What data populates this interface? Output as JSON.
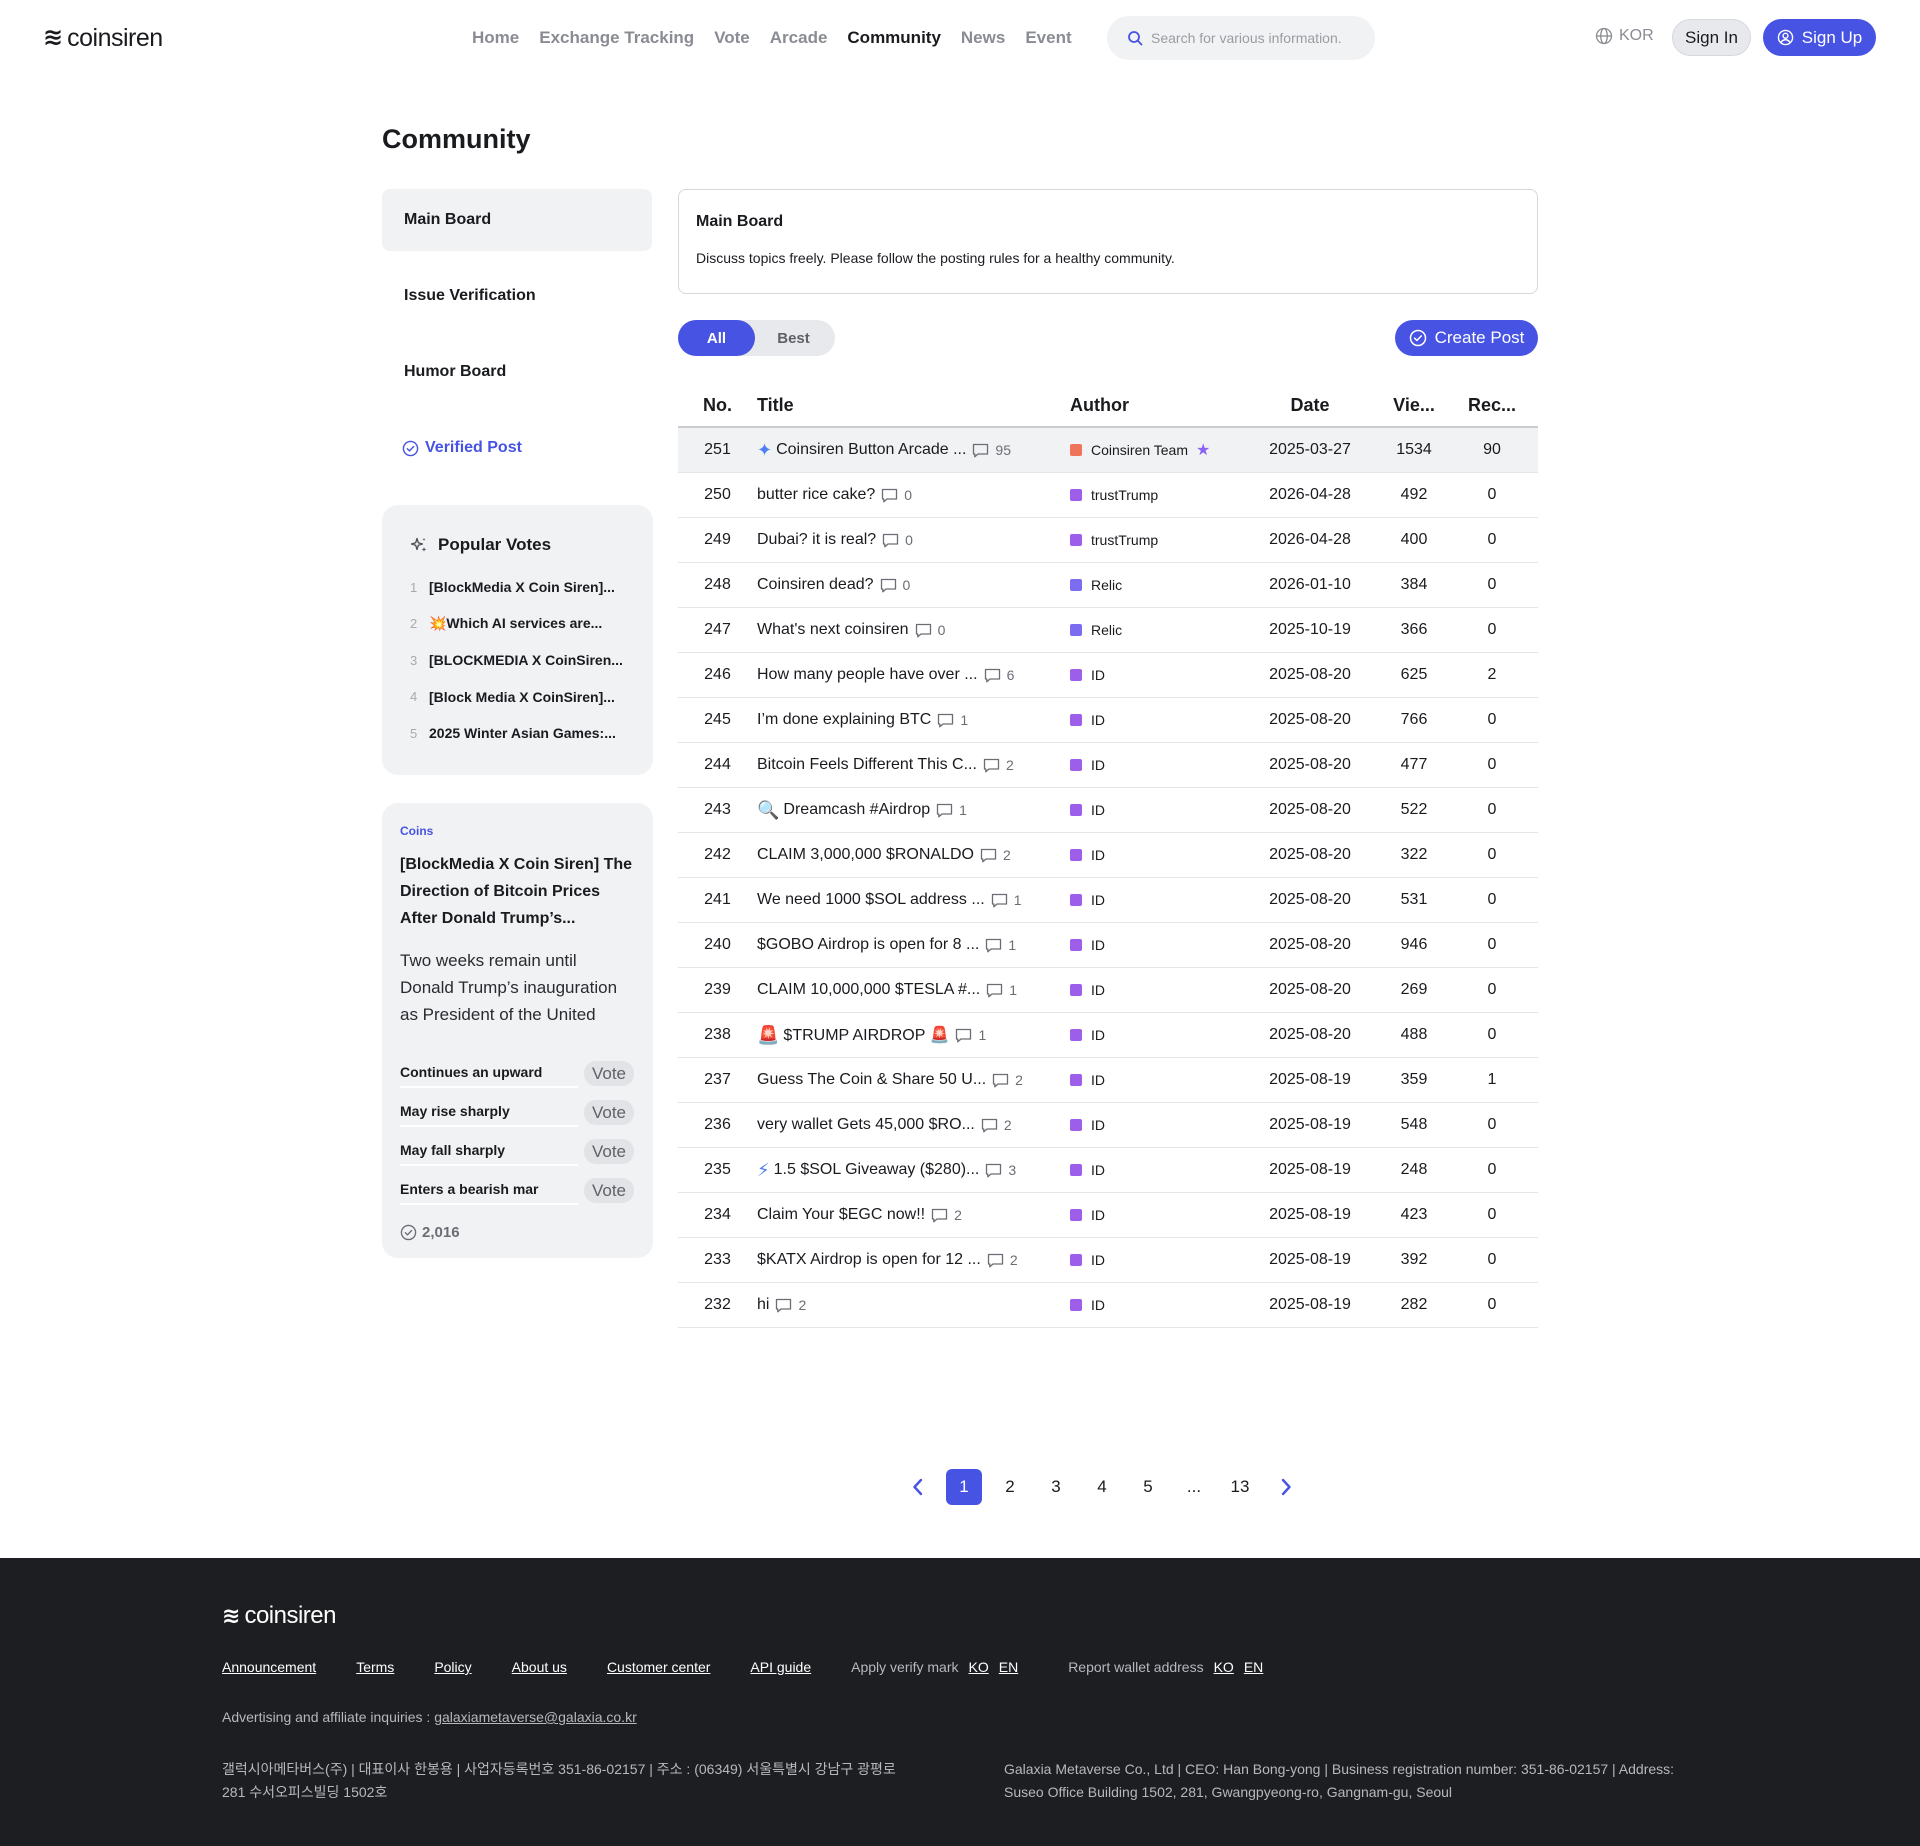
{
  "header": {
    "logo_mark": "≋",
    "logo_text": "coinsiren",
    "nav": [
      "Home",
      "Exchange Tracking",
      "Vote",
      "Arcade",
      "Community",
      "News",
      "Event"
    ],
    "active_nav": "Community",
    "search_placeholder": "Search for various information.",
    "lang": "KOR",
    "sign_in": "Sign In",
    "sign_up": "Sign Up",
    "accent_color": "#4753e3"
  },
  "page_title": "Community",
  "sidebar": {
    "items": [
      {
        "label": "Main Board",
        "active": true
      },
      {
        "label": "Issue Verification",
        "active": false
      },
      {
        "label": "Humor Board",
        "active": false
      },
      {
        "label": "Verified Post",
        "active": false
      }
    ],
    "popular_votes": {
      "title": "Popular Votes",
      "items": [
        {
          "num": "1",
          "text": "[BlockMedia X Coin Siren]..."
        },
        {
          "num": "2",
          "text": "💥Which AI services are..."
        },
        {
          "num": "3",
          "text": "[BLOCKMEDIA X CoinSiren..."
        },
        {
          "num": "4",
          "text": "[Block Media X CoinSiren]..."
        },
        {
          "num": "5",
          "text": "2025 Winter Asian Games:..."
        }
      ]
    },
    "vote_card": {
      "category": "Coins",
      "title": "[BlockMedia X Coin Siren] The Direction of Bitcoin Prices After Donald Trump’s...",
      "description": "Two weeks remain until Donald Trump’s inauguration as President of the United State...",
      "options": [
        {
          "label": "Continues an upward",
          "button": "Vote"
        },
        {
          "label": "May rise sharply",
          "button": "Vote"
        },
        {
          "label": "May fall sharply",
          "button": "Vote"
        },
        {
          "label": "Enters a bearish mar",
          "button": "Vote"
        }
      ],
      "count": "2,016"
    }
  },
  "board": {
    "title": "Main Board",
    "description": "Discuss topics freely. Please follow the posting rules for a healthy community.",
    "filters": [
      "All",
      "Best"
    ],
    "active_filter": "All",
    "create_post": "Create Post",
    "columns": [
      "No.",
      "Title",
      "Author",
      "Date",
      "Vie...",
      "Rec..."
    ],
    "rows": [
      {
        "no": "251",
        "prefix": "✦",
        "title": "Coinsiren Button Arcade ...",
        "comments": "95",
        "author": "Coinsiren Team",
        "level": "team",
        "star": true,
        "date": "2025-03-27",
        "views": "1534",
        "rec": "90",
        "pinned": true
      },
      {
        "no": "250",
        "prefix": "",
        "title": "butter rice cake?",
        "comments": "0",
        "author": "trustTrump",
        "level": "normal",
        "star": false,
        "date": "2026-04-28",
        "views": "492",
        "rec": "0",
        "pinned": false
      },
      {
        "no": "249",
        "prefix": "",
        "title": "Dubai? it is real?",
        "comments": "0",
        "author": "trustTrump",
        "level": "normal",
        "star": false,
        "date": "2026-04-28",
        "views": "400",
        "rec": "0",
        "pinned": false
      },
      {
        "no": "248",
        "prefix": "",
        "title": "Coinsiren dead?",
        "comments": "0",
        "author": "Relic",
        "level": "relic",
        "star": false,
        "date": "2026-01-10",
        "views": "384",
        "rec": "0",
        "pinned": false
      },
      {
        "no": "247",
        "prefix": "",
        "title": "What's next coinsiren",
        "comments": "0",
        "author": "Relic",
        "level": "relic",
        "star": false,
        "date": "2025-10-19",
        "views": "366",
        "rec": "0",
        "pinned": false
      },
      {
        "no": "246",
        "prefix": "",
        "title": "How many people have over ...",
        "comments": "6",
        "author": "ID",
        "level": "normal",
        "star": false,
        "date": "2025-08-20",
        "views": "625",
        "rec": "2",
        "pinned": false
      },
      {
        "no": "245",
        "prefix": "",
        "title": "I’m done explaining BTC",
        "comments": "1",
        "author": "ID",
        "level": "normal",
        "star": false,
        "date": "2025-08-20",
        "views": "766",
        "rec": "0",
        "pinned": false
      },
      {
        "no": "244",
        "prefix": "",
        "title": "Bitcoin Feels Different This C...",
        "comments": "2",
        "author": "ID",
        "level": "normal",
        "star": false,
        "date": "2025-08-20",
        "views": "477",
        "rec": "0",
        "pinned": false
      },
      {
        "no": "243",
        "prefix": "🔍",
        "title": "Dreamcash #Airdrop",
        "comments": "1",
        "author": "ID",
        "level": "normal",
        "star": false,
        "date": "2025-08-20",
        "views": "522",
        "rec": "0",
        "pinned": false
      },
      {
        "no": "242",
        "prefix": "",
        "title": "CLAIM 3,000,000 $RONALDO",
        "comments": "2",
        "author": "ID",
        "level": "normal",
        "star": false,
        "date": "2025-08-20",
        "views": "322",
        "rec": "0",
        "pinned": false
      },
      {
        "no": "241",
        "prefix": "",
        "title": "We need 1000 $SOL address ...",
        "comments": "1",
        "author": "ID",
        "level": "normal",
        "star": false,
        "date": "2025-08-20",
        "views": "531",
        "rec": "0",
        "pinned": false
      },
      {
        "no": "240",
        "prefix": "",
        "title": "$GOBO Airdrop is open for 8 ...",
        "comments": "1",
        "author": "ID",
        "level": "normal",
        "star": false,
        "date": "2025-08-20",
        "views": "946",
        "rec": "0",
        "pinned": false
      },
      {
        "no": "239",
        "prefix": "",
        "title": "CLAIM 10,000,000 $TESLA #...",
        "comments": "1",
        "author": "ID",
        "level": "normal",
        "star": false,
        "date": "2025-08-20",
        "views": "269",
        "rec": "0",
        "pinned": false
      },
      {
        "no": "238",
        "prefix": "🚨",
        "title": "$TRUMP AIRDROP 🚨",
        "comments": "1",
        "author": "ID",
        "level": "normal",
        "star": false,
        "date": "2025-08-20",
        "views": "488",
        "rec": "0",
        "pinned": false
      },
      {
        "no": "237",
        "prefix": "",
        "title": "Guess The Coin & Share 50 U...",
        "comments": "2",
        "author": "ID",
        "level": "normal",
        "star": false,
        "date": "2025-08-19",
        "views": "359",
        "rec": "1",
        "pinned": false
      },
      {
        "no": "236",
        "prefix": "",
        "title": "very wallet Gets 45,000 $RO...",
        "comments": "2",
        "author": "ID",
        "level": "normal",
        "star": false,
        "date": "2025-08-19",
        "views": "548",
        "rec": "0",
        "pinned": false
      },
      {
        "no": "235",
        "prefix": "⚡",
        "title": "1.5 $SOL Giveaway ($280)...",
        "comments": "3",
        "author": "ID",
        "level": "normal",
        "star": false,
        "date": "2025-08-19",
        "views": "248",
        "rec": "0",
        "pinned": false
      },
      {
        "no": "234",
        "prefix": "",
        "title": "Claim Your $EGC now!!",
        "comments": "2",
        "author": "ID",
        "level": "normal",
        "star": false,
        "date": "2025-08-19",
        "views": "423",
        "rec": "0",
        "pinned": false
      },
      {
        "no": "233",
        "prefix": "",
        "title": "$KATX Airdrop is open for 12 ...",
        "comments": "2",
        "author": "ID",
        "level": "normal",
        "star": false,
        "date": "2025-08-19",
        "views": "392",
        "rec": "0",
        "pinned": false
      },
      {
        "no": "232",
        "prefix": "",
        "title": "hi",
        "comments": "2",
        "author": "ID",
        "level": "normal",
        "star": false,
        "date": "2025-08-19",
        "views": "282",
        "rec": "0",
        "pinned": false
      }
    ]
  },
  "pagination": {
    "pages": [
      "1",
      "2",
      "3",
      "4",
      "5",
      "...",
      "13"
    ],
    "current": "1"
  },
  "footer": {
    "logo_mark": "≋",
    "logo_text": "coinsiren",
    "links": [
      "Announcement",
      "Terms",
      "Policy",
      "About us",
      "Customer center",
      "API guide"
    ],
    "verify_label": "Apply verify mark",
    "report_label": "Report wallet address",
    "lang_ko": "KO",
    "lang_en": "EN",
    "contact_label": "Advertising and affiliate inquiries : ",
    "contact_email": "galaxiametaverse@galaxia.co.kr",
    "company_kr": "갤럭시아메타버스(주)  |  대표이사 한봉용  |  사업자등록번호 351-86-02157  |  주소 : (06349) 서울특별시 강남구 광평로 281 수서오피스빌딩 1502호",
    "company_en": "Galaxia Metaverse Co., Ltd  |  CEO: Han Bong-yong  |  Business registration number: 351-86-02157  |  Address: Suseo Office Building 1502, 281, Gwangpyeong-ro, Gangnam-gu, Seoul"
  }
}
